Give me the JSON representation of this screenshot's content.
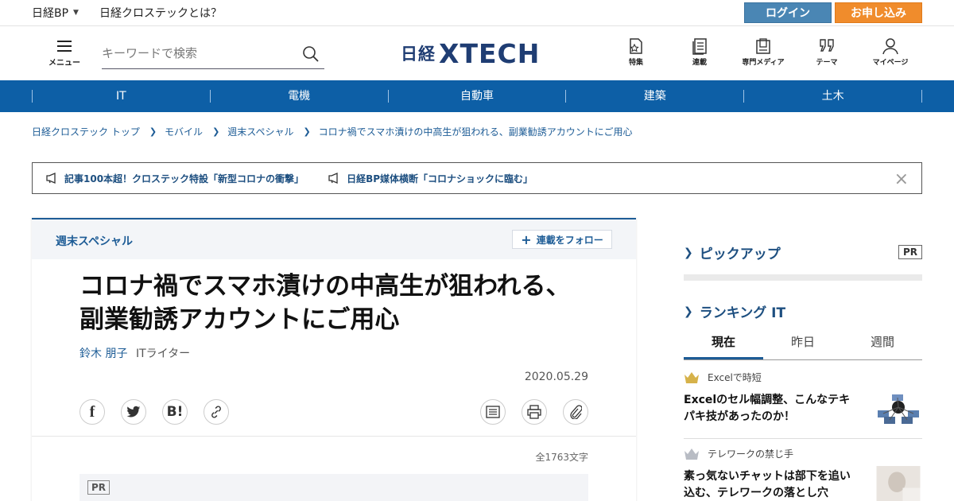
{
  "topbar": {
    "brand": "日経BP",
    "about": "日経クロステックとは？",
    "login": "ログイン",
    "signup": "お申し込み"
  },
  "header": {
    "menu_label": "メニュー",
    "search_placeholder": "キーワードで検索",
    "logo_nikkei": "日経",
    "logo_xtech": "XTECH",
    "nav": [
      {
        "label": "特集",
        "icon": "feature-icon"
      },
      {
        "label": "連載",
        "icon": "series-icon"
      },
      {
        "label": "専門メディア",
        "icon": "media-icon"
      },
      {
        "label": "テーマ",
        "icon": "theme-icon"
      },
      {
        "label": "マイページ",
        "icon": "user-icon"
      }
    ]
  },
  "categories": [
    "IT",
    "電機",
    "自動車",
    "建築",
    "土木"
  ],
  "breadcrumb": [
    "日経クロステック トップ",
    "モバイル",
    "週末スペシャル",
    "コロナ禍でスマホ漬けの中高生が狙われる、副業勧誘アカウントにご用心"
  ],
  "notice": {
    "items": [
      "記事100本超！クロステック特設「新型コロナの衝撃」",
      "日経BP媒体横断「コロナショックに臨む」"
    ],
    "close": "×"
  },
  "article": {
    "series": "週末スペシャル",
    "follow": "連載をフォロー",
    "title": "コロナ禍でスマホ漬けの中高生が狙われる、副業勧誘アカウントにご用心",
    "author": "鈴木 朋子",
    "author_role": "ITライター",
    "date": "2020.05.29",
    "char_count": "全1763文字",
    "pr": "PR"
  },
  "sidebar": {
    "pickup": "ピックアップ",
    "pr": "PR",
    "ranking": "ランキング IT",
    "tabs": [
      "現在",
      "昨日",
      "週間"
    ],
    "items": [
      {
        "category": "Excelで時短",
        "title": "Excelのセル幅調整、こんなテキパキ技があったのか！"
      },
      {
        "category": "テレワークの禁じ手",
        "title": "素っ気ないチャットは部下を追い込む、テレワークの落とし穴"
      }
    ]
  },
  "colors": {
    "brand_blue": "#0d5fa6",
    "link_blue": "#1d5c96",
    "login": "#4a86b4",
    "signup": "#f08c2c"
  }
}
